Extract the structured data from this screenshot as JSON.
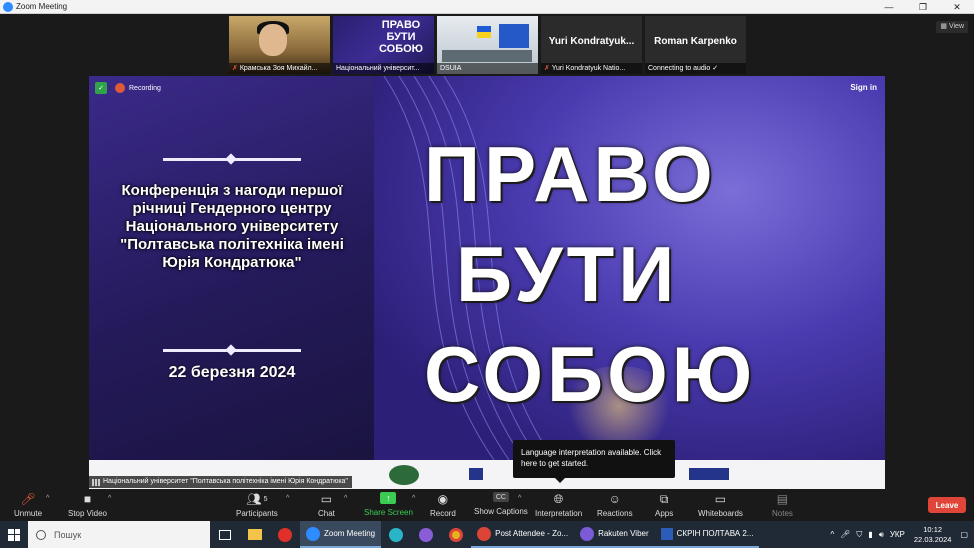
{
  "window": {
    "title": "Zoom Meeting",
    "controls": [
      "—",
      "❐",
      "✕"
    ]
  },
  "participants": [
    {
      "caption": "Крамська Зоя Михайл..."
    },
    {
      "caption": "Національний університ...",
      "preview_title": "ПРАВО БУТИ СОБОЮ"
    },
    {
      "caption": "DSUIA"
    },
    {
      "big_name": "Yuri Kondratyuk...",
      "caption": "Yuri Kondratyuk Natio..."
    },
    {
      "big_name": "Roman Karpenko",
      "caption": "Connecting to audio ✓"
    }
  ],
  "view_label": "View",
  "share": {
    "recording_label": "Recording",
    "sign_in": "Sign in",
    "conference_text": "Конференція з нагоди першої річниці Гендерного центру Національного університету \"Полтавська політехніка імені Юрія Кондратюка\"",
    "date_text": "22 березня 2024",
    "title_line1": "ПРАВО",
    "title_line2": "БУТИ",
    "title_line3": "СОБОЮ",
    "sharer_caption": "Національний університет \"Полтавська політехніка імені Юрія Кондратюка\""
  },
  "tooltip": "Language interpretation available. Click here to get started.",
  "toolbar": {
    "unmute": "Unmute",
    "stop_video": "Stop Video",
    "participants": "Participants",
    "participants_count": "5",
    "chat": "Chat",
    "share_screen": "Share Screen",
    "record": "Record",
    "show_captions": "Show Captions",
    "interpretation": "Interpretation",
    "reactions": "Reactions",
    "apps": "Apps",
    "whiteboards": "Whiteboards",
    "notes": "Notes",
    "leave": "Leave"
  },
  "taskbar": {
    "search_placeholder": "Пошук",
    "apps": [
      {
        "label": "Zoom Meeting"
      },
      {
        "label": "Post Attendee - Zo..."
      },
      {
        "label": "Rakuten Viber"
      },
      {
        "label": "СКРІН ПОЛТАВА 2..."
      }
    ],
    "lang": "УКР",
    "time": "10:12",
    "date": "22.03.2024"
  },
  "colors": {
    "leave": "#e0453a",
    "share_green": "#3bcb53",
    "slide_bg": "#2c1f78"
  }
}
